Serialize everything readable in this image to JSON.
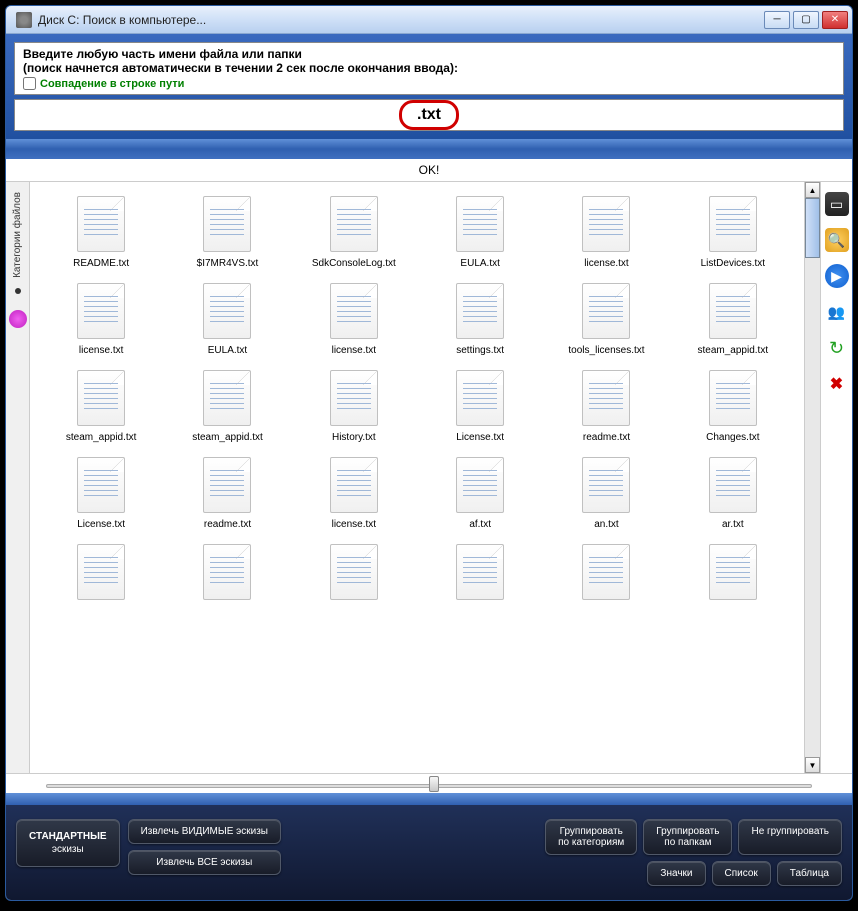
{
  "window": {
    "title": "Диск C: Поиск в компьютере..."
  },
  "info": {
    "line1": "Введите любую часть имени файла или папки",
    "line2": "(поиск начнется автоматически в течении 2 сек после окончания ввода):",
    "checkbox_label": "Совпадение в строке пути"
  },
  "search": {
    "value": ".txt"
  },
  "status": {
    "text": "OK!"
  },
  "sidebar": {
    "categories_label": "Категории файлов"
  },
  "files": [
    "README.txt",
    "$I7MR4VS.txt",
    "SdkConsoleLog.txt",
    "EULA.txt",
    "license.txt",
    "ListDevices.txt",
    "license.txt",
    "EULA.txt",
    "license.txt",
    "settings.txt",
    "tools_licenses.txt",
    "steam_appid.txt",
    "steam_appid.txt",
    "steam_appid.txt",
    "History.txt",
    "License.txt",
    "readme.txt",
    "Changes.txt",
    "License.txt",
    "readme.txt",
    "license.txt",
    "af.txt",
    "an.txt",
    "ar.txt",
    "",
    "",
    "",
    "",
    "",
    ""
  ],
  "buttons": {
    "standard_sketches_l1": "СТАНДАРТНЫЕ",
    "standard_sketches_l2": "эскизы",
    "extract_visible": "Извлечь ВИДИМЫЕ эскизы",
    "extract_all": "Извлечь ВСЕ эскизы",
    "group_cat_l1": "Группировать",
    "group_cat_l2": "по категориям",
    "group_folder_l1": "Группировать",
    "group_folder_l2": "по папкам",
    "no_group": "Не группировать",
    "icons": "Значки",
    "list": "Список",
    "table": "Таблица"
  }
}
